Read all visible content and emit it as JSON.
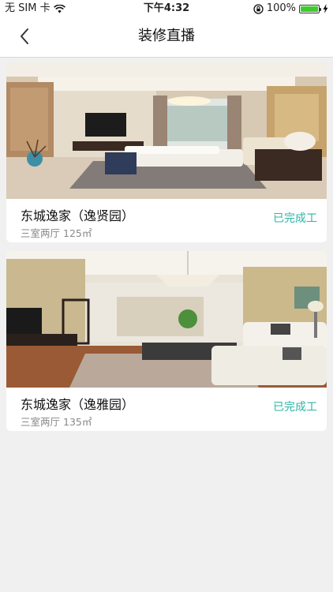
{
  "status_bar": {
    "carrier": "无 SIM 卡",
    "time": "下午4:32",
    "battery": "100%",
    "battery_level": 1.0
  },
  "nav": {
    "title": "装修直播"
  },
  "accent": "#2bb5a5",
  "cards": [
    {
      "name": "东城逸家（逸贤园）",
      "layout": "三室两厅",
      "area": "125㎡",
      "status": "已完成工"
    },
    {
      "name": "东城逸家（逸雅园）",
      "layout": "三室两厅",
      "area": "135㎡",
      "status": "已完成工"
    }
  ]
}
